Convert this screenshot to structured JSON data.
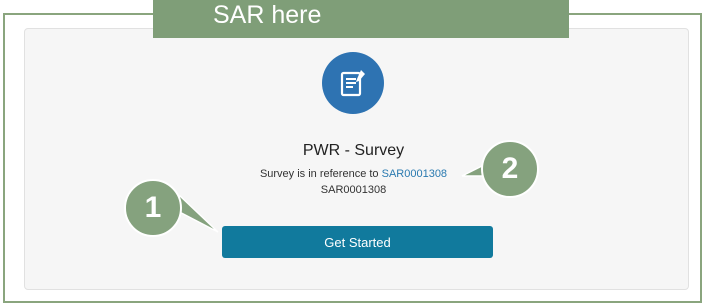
{
  "annotation": {
    "banner_text": "SAR here",
    "badge_1": "1",
    "badge_2": "2"
  },
  "survey": {
    "title": "PWR - Survey",
    "reference_prefix": "Survey is in reference to ",
    "reference_link": "SAR0001308",
    "reference_id": "SAR0001308",
    "start_button": "Get Started"
  },
  "icons": {
    "survey_icon": "clipboard-document-icon"
  },
  "colors": {
    "icon_bg": "#2e73b2",
    "button_bg": "#117a9d",
    "link": "#2a7ab0",
    "annotation": "#85a27e"
  }
}
